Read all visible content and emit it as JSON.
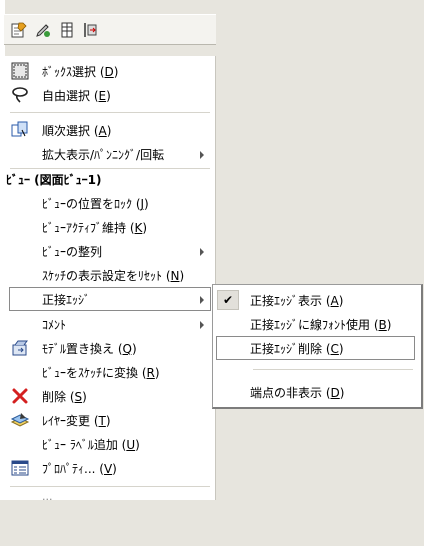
{
  "toolbar": {
    "buttons": [
      "model-doc-icon",
      "edit-sketch-icon",
      "table-icon",
      "rebuild-icon"
    ]
  },
  "menu": {
    "items": [
      {
        "label": "ﾎﾞｯｸｽ選択 (D)",
        "icon": "box-select-icon"
      },
      {
        "label": "自由選択 (E)",
        "icon": "lasso-select-icon"
      },
      {
        "label": "順次選択 (A)",
        "icon": "sequential-select-icon"
      },
      {
        "label": "拡大表示/ﾊﾟﾝﾆﾝｸﾞ/回転"
      },
      {
        "label": "ﾋﾞｭｰの位置をﾛｯｸ (J)"
      },
      {
        "label": "ﾋﾞｭｰｱｸﾃｨﾌﾞ維持 (K)"
      },
      {
        "label": "ﾋﾞｭｰの整列"
      },
      {
        "label": "ｽｹｯﾁの表示設定をﾘｾｯﾄ (N)"
      },
      {
        "label": "正接ｴｯｼﾞ"
      },
      {
        "label": "ｺﾒﾝﾄ"
      },
      {
        "label": "ﾓﾃﾞﾙ置き換え (Q)",
        "icon": "replace-model-icon"
      },
      {
        "label": "ﾋﾞｭｰをｽｹｯﾁに変換 (R)"
      },
      {
        "label": "削除 (S)",
        "icon": "delete-icon"
      },
      {
        "label": "ﾚｲﾔｰ変更 (T)",
        "icon": "layer-icon"
      },
      {
        "label": "ﾋﾞｭｰ ﾗﾍﾞﾙ追加 (U)"
      },
      {
        "label": "ﾌﾟﾛﾊﾟﾃｨ... (V)",
        "icon": "properties-icon"
      }
    ],
    "section_header": "ﾋﾞｭｰ (図面ﾋﾞｭｰ1)",
    "cut_off_label": "..."
  },
  "submenu": {
    "items": [
      {
        "label": "正接ｴｯｼﾞ表示 (A)",
        "checked": true
      },
      {
        "label": "正接ｴｯｼﾞに線ﾌｫﾝﾄ使用 (B)"
      },
      {
        "label": "正接ｴｯｼﾞ削除 (C)"
      },
      {
        "label": "端点の非表示 (D)"
      }
    ],
    "check_glyph": "✔"
  }
}
